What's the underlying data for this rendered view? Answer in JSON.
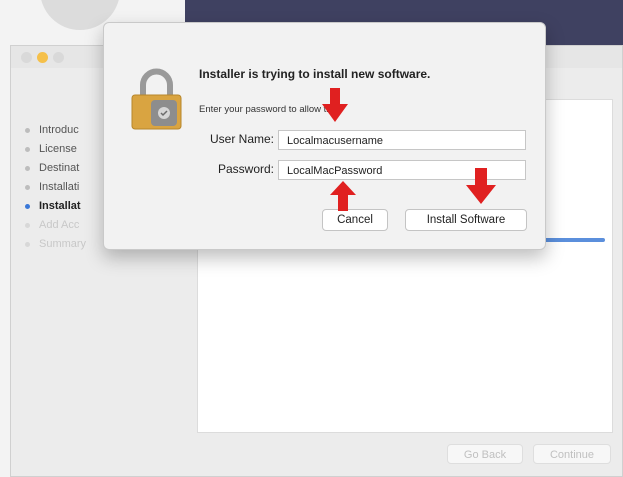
{
  "installer": {
    "steps": [
      {
        "label": "Introduc",
        "state": "done"
      },
      {
        "label": "License",
        "state": "done"
      },
      {
        "label": "Destinat",
        "state": "done"
      },
      {
        "label": "Installati",
        "state": "done"
      },
      {
        "label": "Installat",
        "state": "active"
      },
      {
        "label": "Add Acc",
        "state": "pending"
      },
      {
        "label": "Summary",
        "state": "pending"
      }
    ],
    "go_back_label": "Go Back",
    "continue_label": "Continue",
    "progress_fraction": 1.0
  },
  "dialog": {
    "title": "Installer is trying to install new software.",
    "subtitle": "Enter your password to allow this.",
    "username_label": "User Name:",
    "username_value": "Localmacusername",
    "password_label": "Password:",
    "password_value": "LocalMacPassword",
    "cancel_label": "Cancel",
    "install_label": "Install Software",
    "icon": "lock-icon"
  },
  "colors": {
    "annotation_arrow": "#e02020",
    "active_step": "#3a78d8",
    "progress_bar": "#5b8fdc",
    "lock_gold": "#d9a441"
  },
  "annotations": [
    "arrow-username",
    "arrow-password",
    "arrow-install"
  ]
}
